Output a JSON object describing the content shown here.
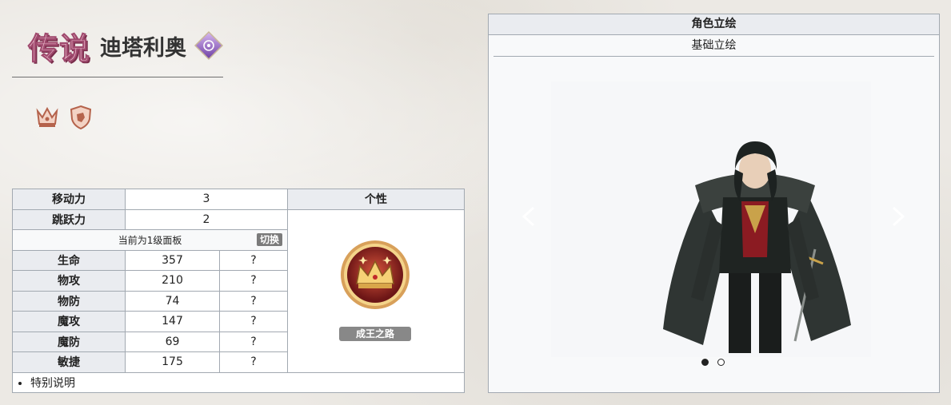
{
  "header": {
    "rarity": "传说",
    "name": "迪塔利奥",
    "class_icon": "purple-diamond-icon"
  },
  "badges": [
    {
      "icon": "crown-badge-icon"
    },
    {
      "icon": "shield-fist-badge-icon"
    }
  ],
  "stats": {
    "move_label": "移动力",
    "move_value": "3",
    "jump_label": "跳跃力",
    "jump_value": "2",
    "panel_note": "当前为1级面板",
    "switch_label": "切换",
    "rows": [
      {
        "label": "生命",
        "value": "357",
        "extra": "?"
      },
      {
        "label": "物攻",
        "value": "210",
        "extra": "?"
      },
      {
        "label": "物防",
        "value": "74",
        "extra": "?"
      },
      {
        "label": "魔攻",
        "value": "147",
        "extra": "?"
      },
      {
        "label": "魔防",
        "value": "69",
        "extra": "?"
      },
      {
        "label": "敏捷",
        "value": "175",
        "extra": "?"
      }
    ],
    "note_item": "特别说明"
  },
  "trait": {
    "header": "个性",
    "name": "成王之路",
    "icon": "crown-emblem-icon"
  },
  "portrait": {
    "title": "角色立绘",
    "tab": "基础立绘",
    "prev_icon": "chevron-left-icon",
    "next_icon": "chevron-right-icon",
    "dots_count": 2,
    "active_dot": 0
  },
  "colors": {
    "rarity_fill": "#f3c8d6",
    "header_bg": "#eaecf0",
    "border": "#a2a9b1",
    "label_bg": "#888888"
  }
}
